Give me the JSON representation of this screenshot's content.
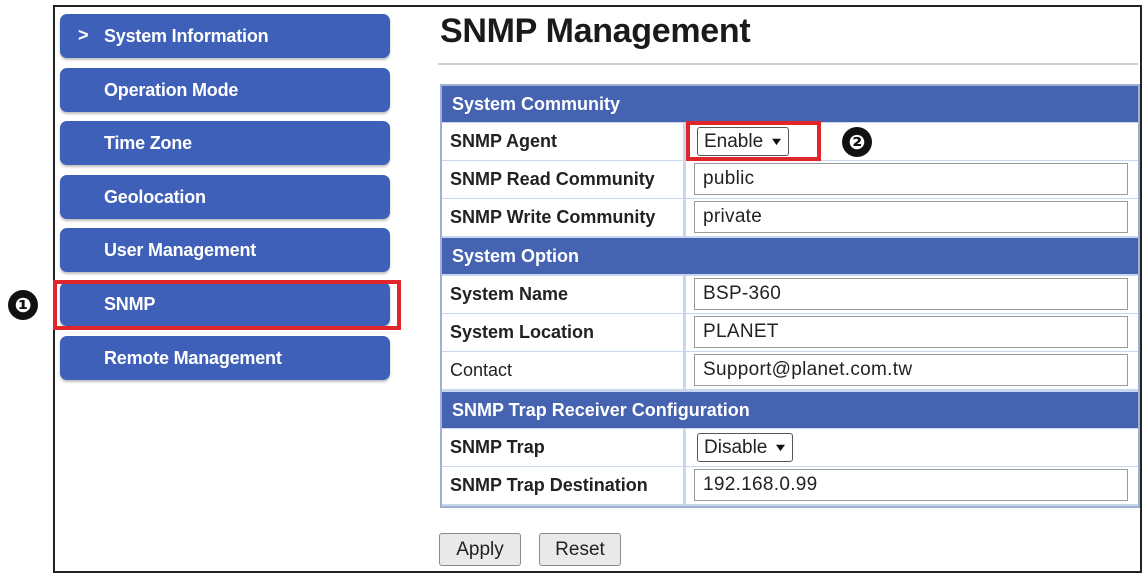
{
  "sidebar": {
    "chevron": ">",
    "items": [
      {
        "label": "System Information"
      },
      {
        "label": "Operation Mode"
      },
      {
        "label": "Time Zone"
      },
      {
        "label": "Geolocation"
      },
      {
        "label": "User Management"
      },
      {
        "label": "SNMP"
      },
      {
        "label": "Remote Management"
      }
    ]
  },
  "annotations": {
    "step1": "❶",
    "step2": "❷",
    "marker_color": "#e0262b"
  },
  "page": {
    "title": "SNMP Management"
  },
  "sections": {
    "community": {
      "header": "System Community",
      "agent_label": "SNMP Agent",
      "agent_value": "Enable",
      "read_label": "SNMP Read Community",
      "read_value": "public",
      "write_label": "SNMP Write Community",
      "write_value": "private"
    },
    "option": {
      "header": "System Option",
      "name_label": "System Name",
      "name_value": "BSP-360",
      "location_label": "System Location",
      "location_value": "PLANET",
      "contact_label": "Contact",
      "contact_value": "Support@planet.com.tw"
    },
    "trap": {
      "header": "SNMP Trap Receiver Configuration",
      "trap_label": "SNMP Trap",
      "trap_value": "Disable",
      "dest_label": "SNMP Trap Destination",
      "dest_value": "192.168.0.99"
    }
  },
  "actions": {
    "apply_label": "Apply",
    "reset_label": "Reset"
  },
  "colors": {
    "sidebar_button": "#3f60b8",
    "section_header": "#4563b1",
    "table_background": "#c9d6ee"
  }
}
